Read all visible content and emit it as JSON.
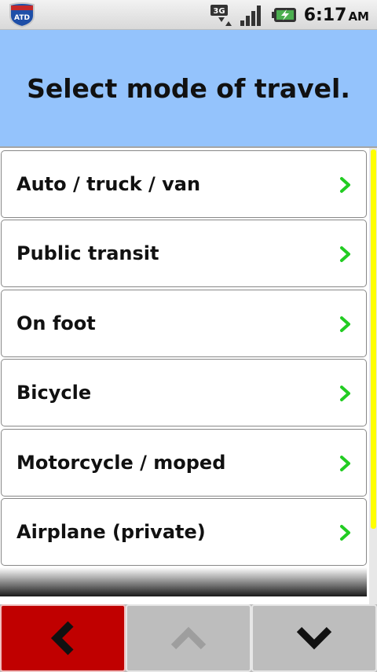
{
  "status_bar": {
    "app_icon_text": "ATD",
    "network_type": "3G",
    "time": "6:17",
    "ampm": "AM"
  },
  "header": {
    "title": "Select mode of travel."
  },
  "travel_modes": [
    {
      "label": "Auto / truck / van"
    },
    {
      "label": "Public transit"
    },
    {
      "label": "On foot"
    },
    {
      "label": "Bicycle"
    },
    {
      "label": "Motorcycle / moped"
    },
    {
      "label": "Airplane (private)"
    }
  ],
  "icons": {
    "row_chevron": "chevron-right-icon",
    "back": "back-arrow-icon",
    "up": "up-arrow-icon",
    "down": "down-arrow-icon"
  },
  "colors": {
    "header_bg": "#94c3fc",
    "chevron": "#22cc22",
    "scroll_thumb": "#ffff00",
    "back_button": "#c00000",
    "nav_button": "#bdbdbd"
  }
}
